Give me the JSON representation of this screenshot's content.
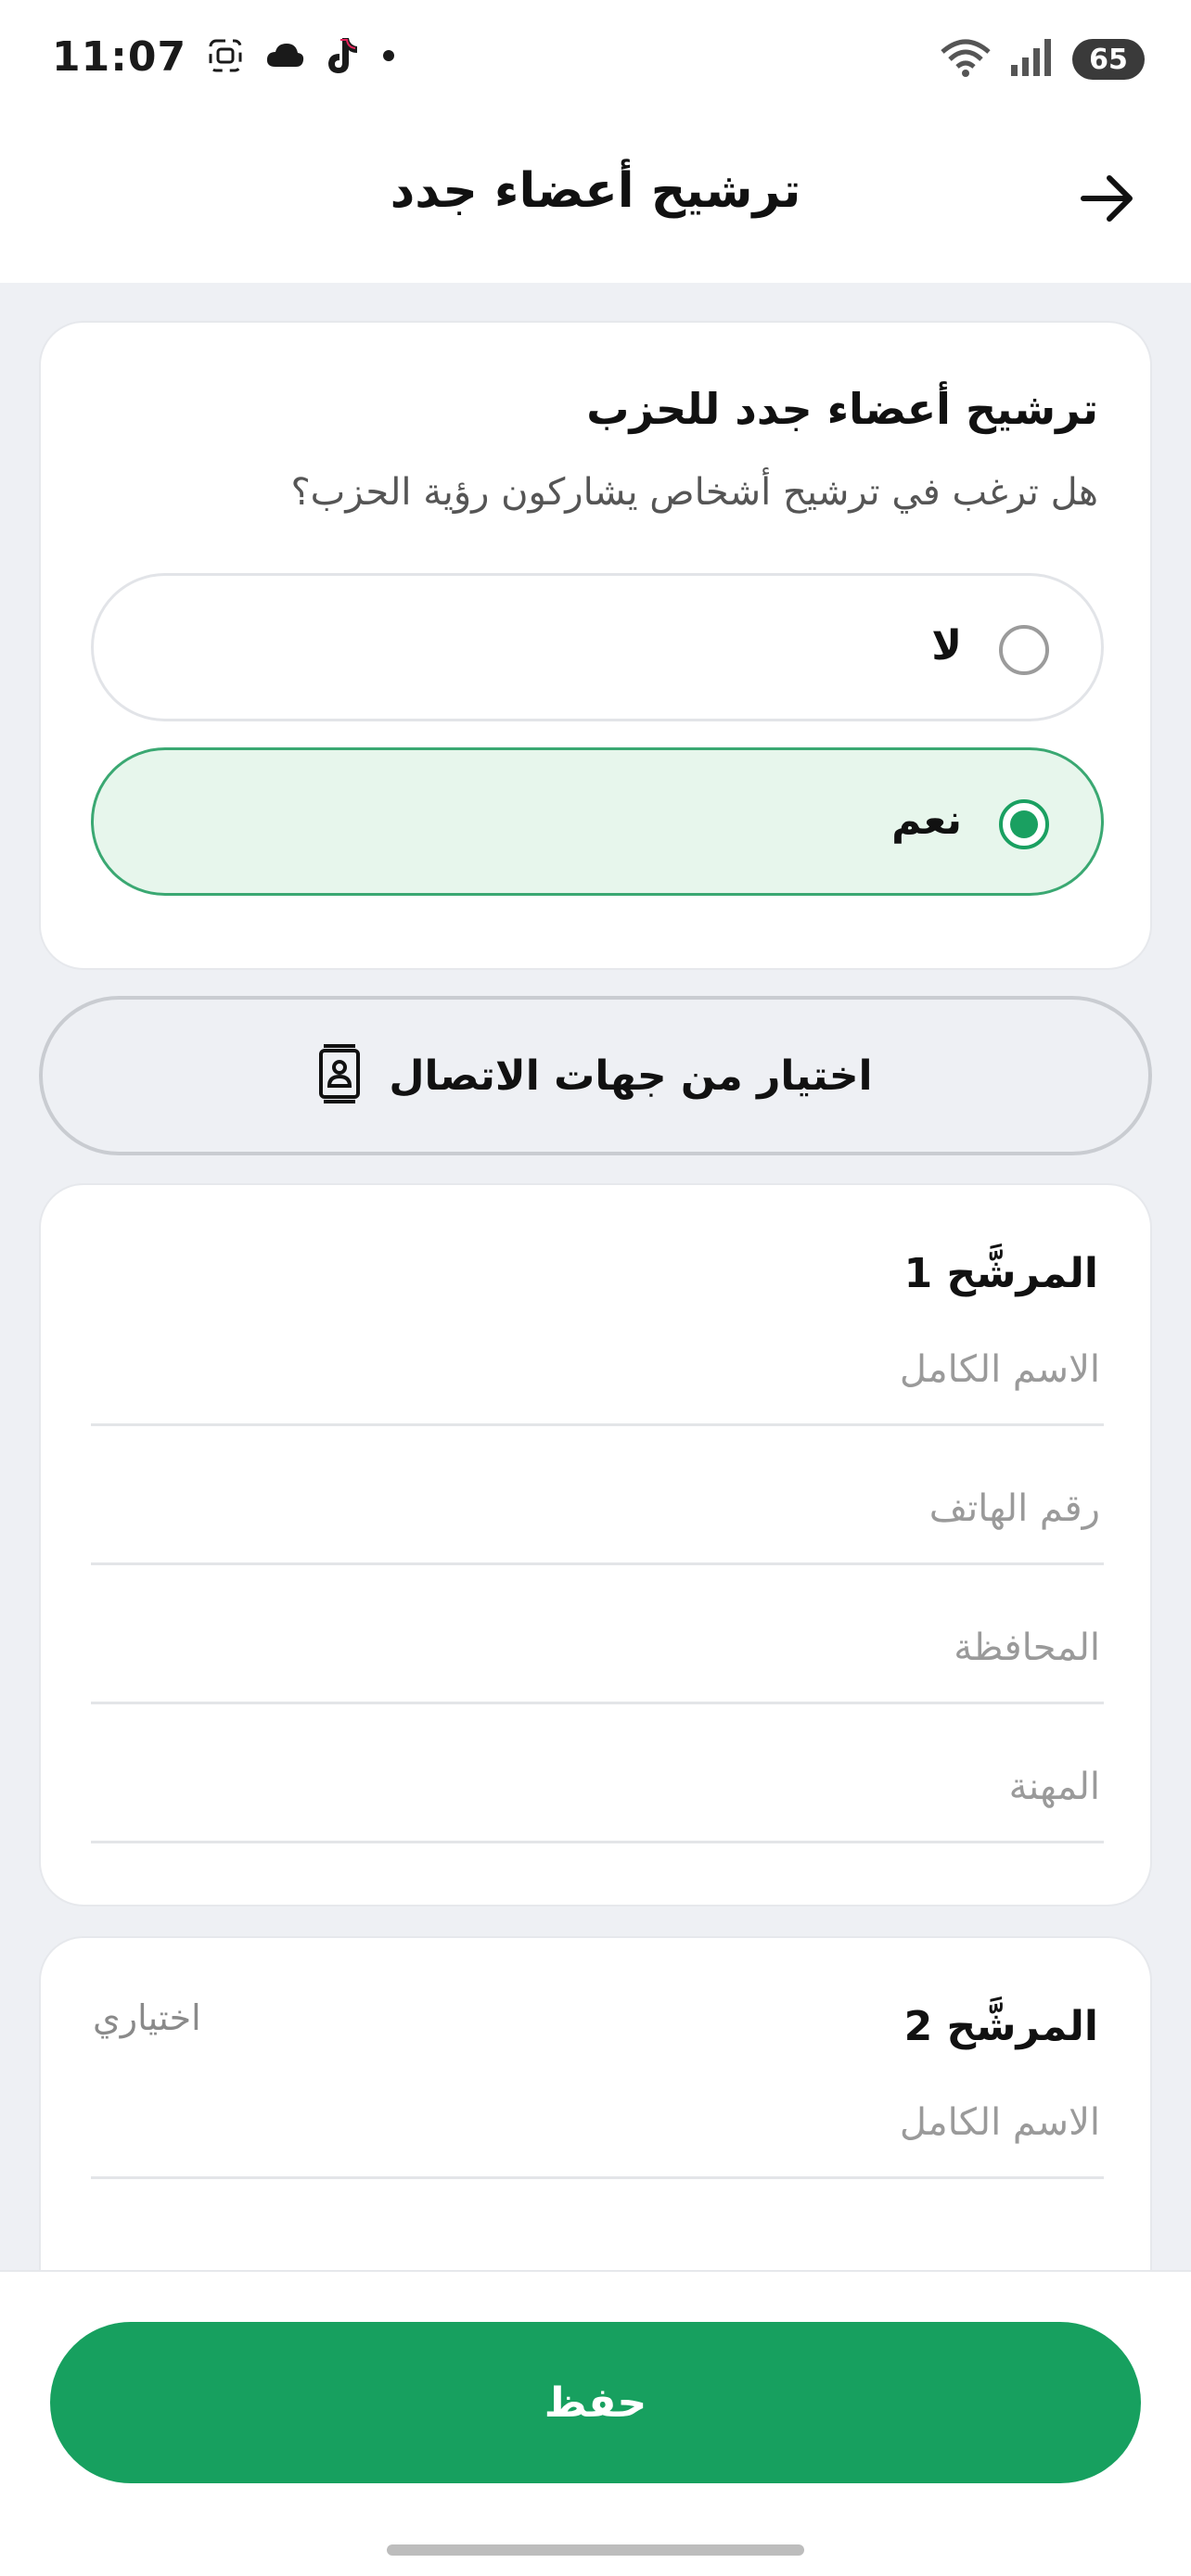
{
  "status_bar": {
    "time": "11:07",
    "left_icons": [
      "screenshot-icon",
      "cloud-icon",
      "tiktok-icon",
      "dot-icon"
    ],
    "right_icons": [
      "wifi-icon",
      "signal-icon"
    ],
    "battery": "65"
  },
  "header": {
    "title": "ترشيح أعضاء جدد",
    "back_icon": "arrow-right-icon"
  },
  "question": {
    "title": "ترشيح أعضاء جدد للحزب",
    "subtitle": "هل ترغب في ترشيح أشخاص يشاركون رؤية الحزب؟",
    "options": [
      {
        "label": "لا",
        "selected": false
      },
      {
        "label": "نعم",
        "selected": true
      }
    ]
  },
  "contacts_button": {
    "label": "اختيار من جهات الاتصال",
    "icon": "contacts-book-icon"
  },
  "candidates": [
    {
      "title": "المرشَّح 1",
      "optional_label": "",
      "fields": [
        {
          "placeholder": "الاسم الكامل",
          "value": ""
        },
        {
          "placeholder": "رقم الهاتف",
          "value": ""
        },
        {
          "placeholder": "المحافظة",
          "value": ""
        },
        {
          "placeholder": "المهنة",
          "value": ""
        }
      ]
    },
    {
      "title": "المرشَّح 2",
      "optional_label": "اختياري",
      "fields": [
        {
          "placeholder": "الاسم الكامل",
          "value": ""
        }
      ]
    }
  ],
  "save_button": {
    "label": "حفظ"
  },
  "colors": {
    "primary_green": "#17a05f",
    "selected_bg": "#e7f6ec",
    "selected_border": "#3aa872",
    "page_bg": "#eef0f4"
  }
}
